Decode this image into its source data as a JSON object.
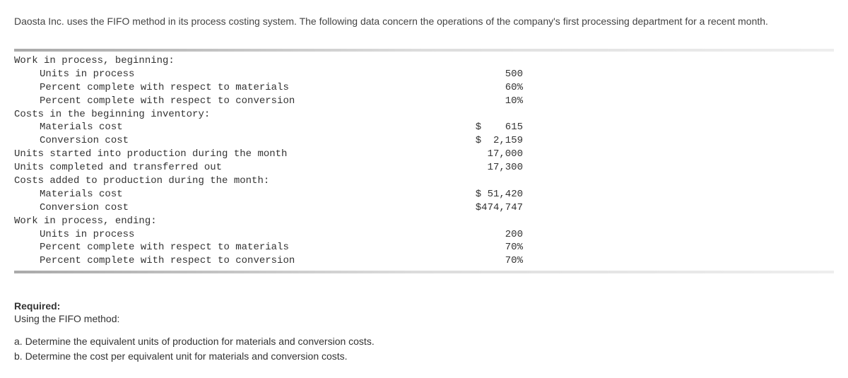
{
  "intro": "Daosta Inc. uses the FIFO method in its process costing system. The following data concern the operations of the company's first processing department for a recent month.",
  "lines": [
    {
      "indent": 0,
      "label": "Work in process, beginning:",
      "value": ""
    },
    {
      "indent": 1,
      "label": "Units in process",
      "value": "500"
    },
    {
      "indent": 1,
      "label": "Percent complete with respect to materials",
      "value": "60%"
    },
    {
      "indent": 1,
      "label": "Percent complete with respect to conversion",
      "value": "10%"
    },
    {
      "indent": 0,
      "label": "Costs in the beginning inventory:",
      "value": ""
    },
    {
      "indent": 1,
      "label": "Materials cost",
      "value": "$    615"
    },
    {
      "indent": 1,
      "label": "Conversion cost",
      "value": "$  2,159"
    },
    {
      "indent": 0,
      "label": "Units started into production during the month",
      "value": "17,000"
    },
    {
      "indent": 0,
      "label": "Units completed and transferred out",
      "value": "17,300"
    },
    {
      "indent": 0,
      "label": "Costs added to production during the month:",
      "value": ""
    },
    {
      "indent": 1,
      "label": "Materials cost",
      "value": "$ 51,420"
    },
    {
      "indent": 1,
      "label": "Conversion cost",
      "value": "$474,747"
    },
    {
      "indent": 0,
      "label": "Work in process, ending:",
      "value": ""
    },
    {
      "indent": 1,
      "label": "Units in process",
      "value": "200"
    },
    {
      "indent": 1,
      "label": "Percent complete with respect to materials",
      "value": "70%"
    },
    {
      "indent": 1,
      "label": "Percent complete with respect to conversion",
      "value": "70%"
    }
  ],
  "required_heading": "Required:",
  "required_sub": "Using the FIFO method:",
  "required_a": "a. Determine the equivalent units of production for materials and conversion costs.",
  "required_b": "b. Determine the cost per equivalent unit for materials and conversion costs."
}
